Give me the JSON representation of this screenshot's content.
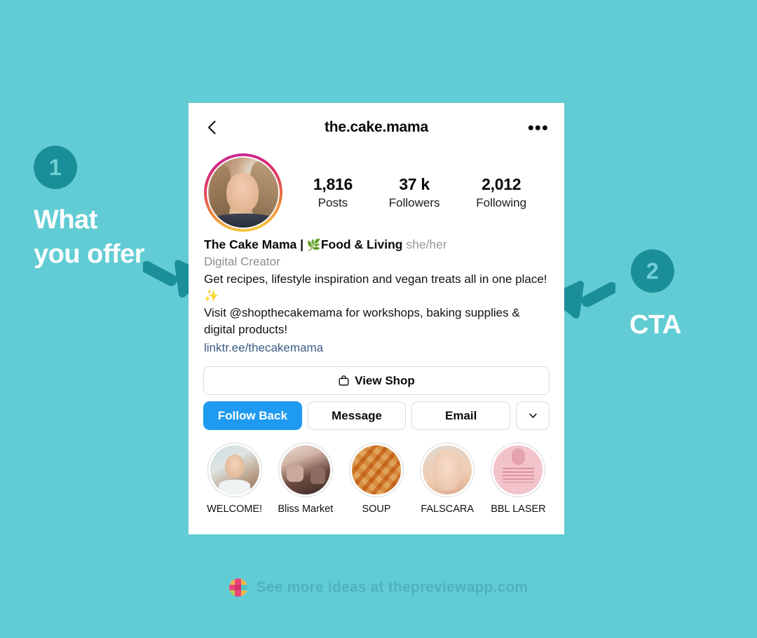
{
  "theme": {
    "background": "#62ccd4",
    "badge_bg": "#1b8f99",
    "badge_fg": "#6fd0d6",
    "arrow_color": "#1b8f99",
    "callout_text_color": "#ffffff",
    "follow_button_bg": "#1e9bf0",
    "link_color": "#3a5b83",
    "footer_text_color": "#4bb3bd"
  },
  "annotations": [
    {
      "number": "1",
      "label_line1": "What",
      "label_line2": "you offer",
      "arrow": "arrow-down-right"
    },
    {
      "number": "2",
      "label_line1": "CTA",
      "label_line2": "",
      "arrow": "arrow-down-left"
    }
  ],
  "profile": {
    "topbar": {
      "back_icon": "chevron-left-icon",
      "username": "the.cake.mama",
      "more_icon": "ellipsis-icon"
    },
    "avatar": {
      "icon": "profile-avatar",
      "has_story_ring": true
    },
    "stats": [
      {
        "value": "1,816",
        "label": "Posts"
      },
      {
        "value": "37 k",
        "label": "Followers"
      },
      {
        "value": "2,012",
        "label": "Following"
      }
    ],
    "bio": {
      "display_name": "The Cake Mama | ",
      "leaf_emoji": "🌿",
      "display_name_tail": "Food & Living",
      "pronouns": "she/her",
      "category": "Digital Creator",
      "lines": [
        "Get recipes, lifestyle inspiration and vegan treats all in one place! ✨",
        "Visit @shopthecakemama for workshops, baking supplies & digital products!"
      ],
      "link": "linktr.ee/thecakemama"
    },
    "buttons": {
      "shop": {
        "label": "View Shop",
        "icon": "shopping-bag-icon"
      },
      "follow": {
        "label": "Follow Back"
      },
      "message": {
        "label": "Message"
      },
      "email": {
        "label": "Email"
      },
      "more": {
        "icon": "chevron-down-icon"
      }
    },
    "highlights": [
      {
        "label": "WELCOME!",
        "thumb": "thumb-welcome"
      },
      {
        "label": "Bliss Market",
        "thumb": "thumb-bliss"
      },
      {
        "label": "SOUP",
        "thumb": "thumb-soup"
      },
      {
        "label": "FALSCARA",
        "thumb": "thumb-falscara"
      },
      {
        "label": "BBL LASER",
        "thumb": "thumb-bbl"
      }
    ]
  },
  "footer": {
    "logo_icon": "preview-app-logo",
    "text": "See more ideas at thepreviewapp.com"
  }
}
